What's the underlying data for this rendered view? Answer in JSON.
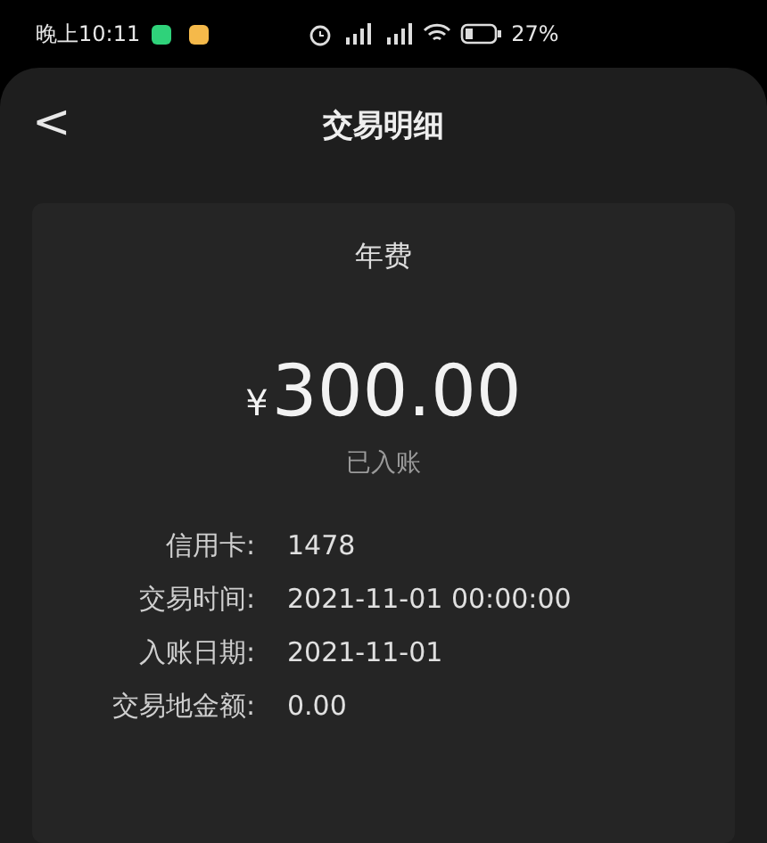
{
  "status_bar": {
    "time": "晚上10:11",
    "battery": "27%"
  },
  "header": {
    "back": "<",
    "title": "交易明细"
  },
  "transaction": {
    "type": "年费",
    "currency": "¥",
    "amount": "300.00",
    "status": "已入账",
    "details": [
      {
        "label": "信用卡:",
        "value": "1478"
      },
      {
        "label": "交易时间:",
        "value": "2021-11-01 00:00:00"
      },
      {
        "label": "入账日期:",
        "value": "2021-11-01"
      },
      {
        "label": "交易地金额:",
        "value": "0.00"
      }
    ]
  }
}
